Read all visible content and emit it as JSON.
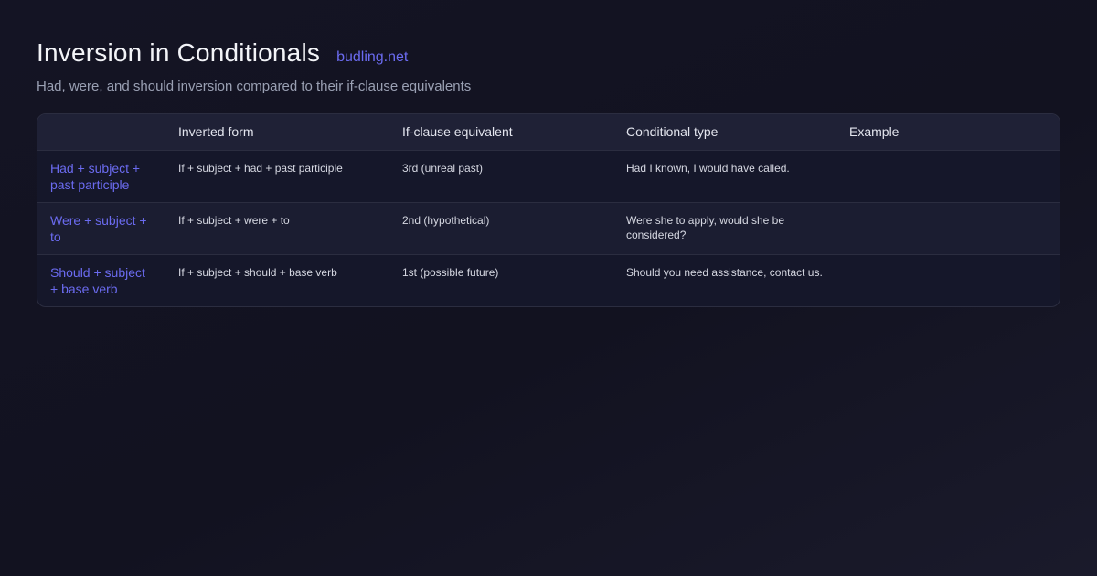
{
  "header": {
    "title": "Inversion in Conditionals",
    "brand": "budling.net",
    "subtitle": "Had, were, and should inversion compared to their if-clause equivalents"
  },
  "table": {
    "columns": [
      "",
      "Inverted form",
      "If-clause equivalent",
      "Conditional type",
      "Example"
    ],
    "rows": [
      {
        "label": "Had + subject + past participle",
        "cells": [
          "If + subject + had + past participle",
          "3rd (unreal past)",
          "Had I known, I would have called.",
          ""
        ]
      },
      {
        "label": "Were + subject + to",
        "cells": [
          "If + subject + were + to",
          "2nd (hypothetical)",
          "Were she to apply, would she be considered?",
          ""
        ]
      },
      {
        "label": "Should + subject + base verb",
        "cells": [
          "If + subject + should + base verb",
          "1st (possible future)",
          "Should you need assistance, contact us.",
          ""
        ]
      }
    ]
  },
  "colors": {
    "accent": "#6b6bf0",
    "background": "#131322",
    "table_header_bg": "#1f2136",
    "border": "#2b2d40"
  }
}
